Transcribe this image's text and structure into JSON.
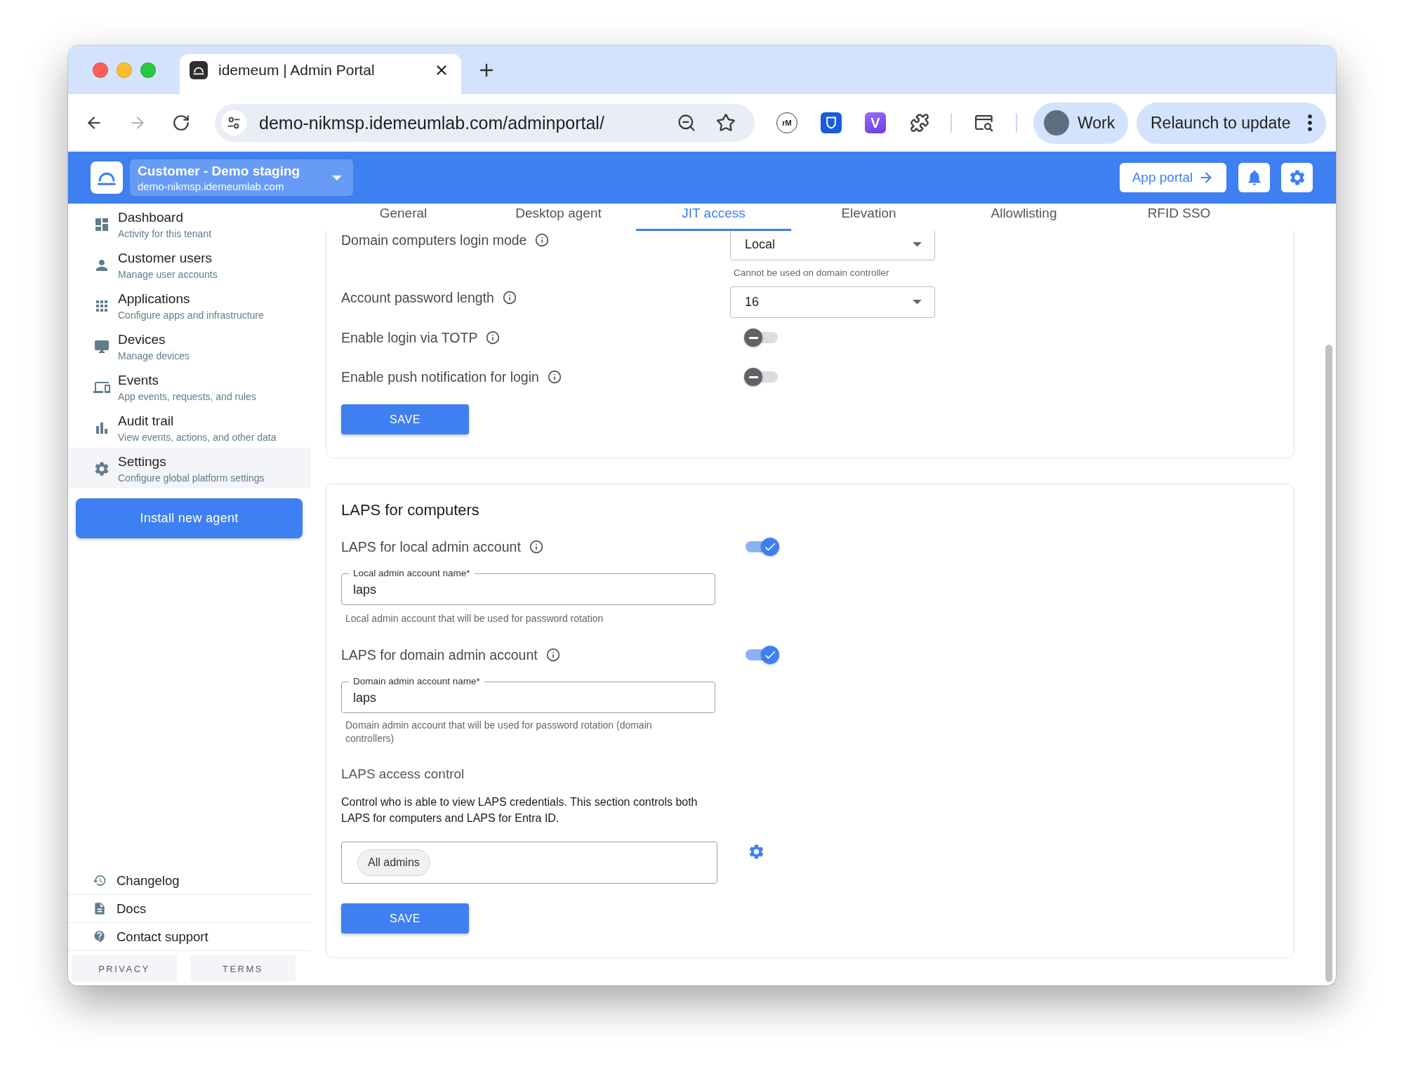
{
  "browser": {
    "tab_title": "idemeum | Admin Portal",
    "nav_buttons": [
      {
        "disabled": false
      },
      {
        "disabled": true
      },
      {
        "disabled": false
      }
    ],
    "url": "demo-nikmsp.idemeumlab.com/adminportal/",
    "extension_labels": [
      "rM",
      "V"
    ],
    "profile": "Work",
    "relaunch": "Relaunch to update"
  },
  "header": {
    "tenant_name": "Customer - Demo staging",
    "tenant_domain": "demo-nikmsp.idemeumlab.com",
    "app_portal": "App portal"
  },
  "sidebar": {
    "nav": [
      {
        "title": "Dashboard",
        "subtitle": "Activity for this tenant",
        "selected": false
      },
      {
        "title": "Customer users",
        "subtitle": "Manage user accounts",
        "selected": false
      },
      {
        "title": "Applications",
        "subtitle": "Configure apps and infrastructure",
        "selected": false
      },
      {
        "title": "Devices",
        "subtitle": "Manage devices",
        "selected": false
      },
      {
        "title": "Events",
        "subtitle": "App events, requests, and rules",
        "selected": false
      },
      {
        "title": "Audit trail",
        "subtitle": "View events, actions, and other data",
        "selected": false
      },
      {
        "title": "Settings",
        "subtitle": "Configure global platform settings",
        "selected": true
      }
    ],
    "install_button": "Install new agent",
    "links": [
      "Changelog",
      "Docs",
      "Contact support"
    ],
    "footer": [
      "PRIVACY",
      "TERMS"
    ]
  },
  "tabs": [
    {
      "label": "General",
      "selected": false
    },
    {
      "label": "Desktop agent",
      "selected": false
    },
    {
      "label": "JIT access",
      "selected": true
    },
    {
      "label": "Elevation",
      "selected": false
    },
    {
      "label": "Allowlisting",
      "selected": false
    },
    {
      "label": "RFID SSO",
      "selected": false
    }
  ],
  "settings": {
    "rows": [
      {
        "kind": "select",
        "label": "Domain computers login mode",
        "value": "Local",
        "hint": "Cannot be used on domain controller"
      },
      {
        "kind": "select",
        "label": "Account password length",
        "value": "16"
      },
      {
        "kind": "toggle",
        "label": "Enable login via TOTP",
        "on": false
      },
      {
        "kind": "toggle",
        "label": "Enable push notification for login",
        "on": false
      }
    ],
    "save": "SAVE"
  },
  "laps": {
    "title": "LAPS for computers",
    "accounts": [
      {
        "label": "LAPS for local admin account",
        "on": true,
        "field_label": "Local admin account name*",
        "value": "laps",
        "helper": "Local admin account that will be used for password rotation"
      },
      {
        "label": "LAPS for domain admin account",
        "on": true,
        "field_label": "Domain admin account name*",
        "value": "laps",
        "helper": "Domain admin account that will be used for password rotation (domain controllers)"
      }
    ],
    "access_control": {
      "title": "LAPS access control",
      "description": "Control who is able to view LAPS credentials. This section controls both LAPS for computers and LAPS for Entra ID.",
      "chips": [
        "All admins"
      ]
    },
    "save": "SAVE"
  }
}
